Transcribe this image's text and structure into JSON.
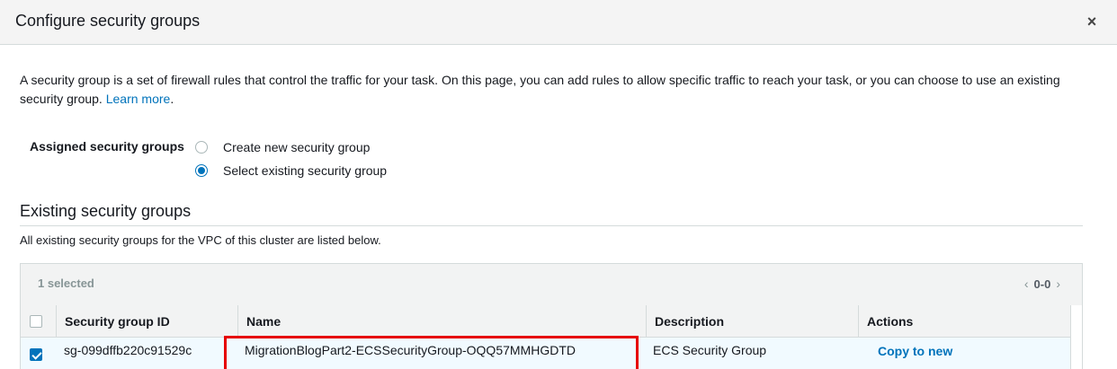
{
  "modal": {
    "title": "Configure security groups",
    "close_symbol": "×"
  },
  "intro": {
    "text": "A security group is a set of firewall rules that control the traffic for your task. On this page, you can add rules to allow specific traffic to reach your task, or you can choose to use an existing security group.",
    "link": "Learn more",
    "after_link": "."
  },
  "assigned": {
    "label": "Assigned security groups",
    "options": [
      {
        "label": "Create new security group",
        "selected": false
      },
      {
        "label": "Select existing security group",
        "selected": true
      }
    ]
  },
  "existing": {
    "title": "Existing security groups",
    "description": "All existing security groups for the VPC of this cluster are listed below."
  },
  "table": {
    "selected_text": "1 selected",
    "pager_range": "0-0",
    "columns": [
      "Security group ID",
      "Name",
      "Description",
      "Actions"
    ],
    "rows": [
      {
        "checked": true,
        "id": "sg-099dffb220c91529c",
        "name": "MigrationBlogPart2-ECSSecurityGroup-OQQ57MMHGDTD",
        "description": "ECS Security Group",
        "action": "Copy to new"
      }
    ]
  },
  "colors": {
    "accent": "#0073bb",
    "highlight": "#e60000"
  }
}
